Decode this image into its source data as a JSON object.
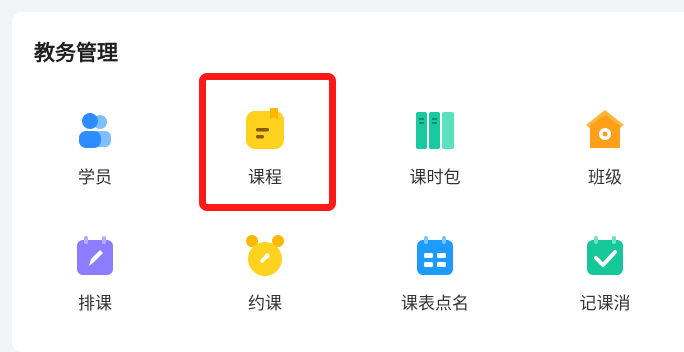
{
  "section": {
    "title": "教务管理",
    "items": [
      {
        "label": "学员",
        "icon": "students-icon",
        "color": "#2d8cff"
      },
      {
        "label": "课程",
        "icon": "course-book-icon",
        "color": "#ffcc1a"
      },
      {
        "label": "课时包",
        "icon": "lesson-package-icon",
        "color": "#1fd1a8"
      },
      {
        "label": "班级",
        "icon": "class-house-icon",
        "color": "#ffa21a"
      },
      {
        "label": "排课",
        "icon": "schedule-calendar-icon",
        "color": "#8c7cff"
      },
      {
        "label": "约课",
        "icon": "booking-alarm-icon",
        "color": "#ffcc1a"
      },
      {
        "label": "课表点名",
        "icon": "roll-call-calendar-icon",
        "color": "#1e9bff"
      },
      {
        "label": "记课消",
        "icon": "record-consumption-icon",
        "color": "#16c79a"
      }
    ]
  },
  "highlight_color": "#ff1a1a"
}
